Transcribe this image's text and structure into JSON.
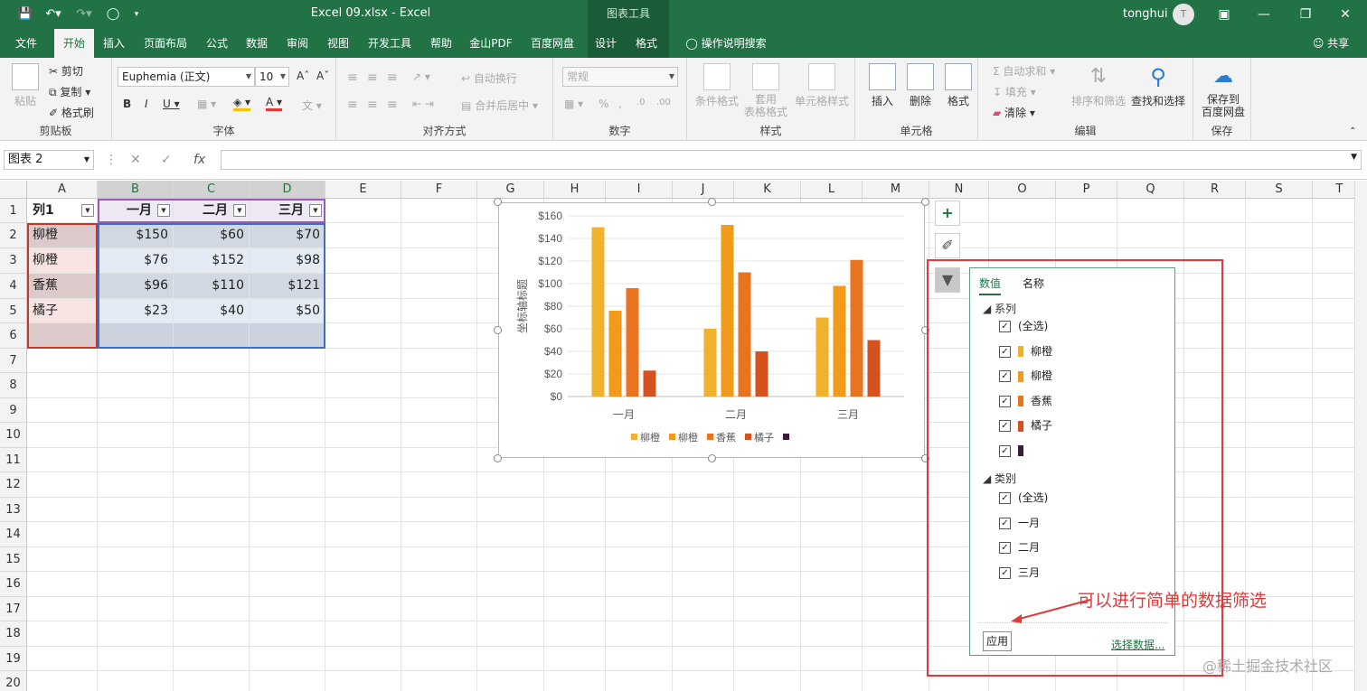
{
  "titlebar": {
    "document_title": "Excel 09.xlsx  -  Excel",
    "context_tools": "图表工具",
    "user": "tonghui",
    "avatar_letter": "T"
  },
  "menu": {
    "tabs": [
      "文件",
      "开始",
      "插入",
      "页面布局",
      "公式",
      "数据",
      "审阅",
      "视图",
      "开发工具",
      "帮助",
      "金山PDF",
      "百度网盘",
      "设计",
      "格式"
    ],
    "search_hint": "操作说明搜索",
    "share": "共享"
  },
  "ribbon": {
    "clipboard": {
      "label": "剪贴板",
      "paste": "粘贴",
      "cut": "剪切",
      "copy": "复制",
      "format_painter": "格式刷"
    },
    "font": {
      "label": "字体",
      "font_name": "Euphemia (正文)",
      "font_size": "10"
    },
    "alignment": {
      "label": "对齐方式",
      "wrap": "自动换行",
      "merge": "合并后居中"
    },
    "number": {
      "label": "数字",
      "format": "常规"
    },
    "styles": {
      "label": "样式",
      "conditional": "条件格式",
      "table_format_1": "套用",
      "table_format_2": "表格格式",
      "cell_styles": "单元格样式"
    },
    "cells": {
      "label": "单元格",
      "insert": "插入",
      "delete": "删除",
      "format": "格式"
    },
    "editing": {
      "label": "编辑",
      "autosum": "自动求和",
      "fill": "填充",
      "clear": "清除",
      "sort_filter": "排序和筛选",
      "find_select": "查找和选择"
    },
    "save": {
      "label": "保存",
      "save_to": "保存到",
      "baidu": "百度网盘"
    }
  },
  "formula_bar": {
    "name_box": "图表 2",
    "fx": "fx",
    "formula": ""
  },
  "sheet": {
    "columns": [
      "A",
      "B",
      "C",
      "D",
      "E",
      "F",
      "G",
      "H",
      "I",
      "J",
      "K",
      "L",
      "M",
      "N",
      "O",
      "P",
      "Q",
      "R",
      "S",
      "T"
    ],
    "rows": [
      "1",
      "2",
      "3",
      "4",
      "5",
      "6",
      "7",
      "8",
      "9",
      "10",
      "11",
      "12",
      "13",
      "14",
      "15",
      "16",
      "17",
      "18",
      "19",
      "20"
    ],
    "headers": [
      "列1",
      "一月",
      "二月",
      "三月"
    ],
    "data": [
      [
        "柳橙",
        "$150",
        "$60",
        "$70"
      ],
      [
        "柳橙",
        "$76",
        "$152",
        "$98"
      ],
      [
        "香蕉",
        "$96",
        "$110",
        "$121"
      ],
      [
        "橘子",
        "$23",
        "$40",
        "$50"
      ]
    ]
  },
  "chart_data": {
    "type": "bar",
    "categories": [
      "一月",
      "二月",
      "三月"
    ],
    "series": [
      {
        "name": "柳橙",
        "values": [
          150,
          60,
          70
        ],
        "color": "#f0b12c"
      },
      {
        "name": "柳橙",
        "values": [
          76,
          152,
          98
        ],
        "color": "#f19a1c"
      },
      {
        "name": "香蕉",
        "values": [
          96,
          110,
          121
        ],
        "color": "#e8741e"
      },
      {
        "name": "橘子",
        "values": [
          23,
          40,
          50
        ],
        "color": "#d5521e"
      },
      {
        "name": "",
        "values": [
          0,
          0,
          0
        ],
        "color": "#3b1a3a"
      }
    ],
    "title": "",
    "xlabel": "",
    "ylabel": "坐标轴标题",
    "ylim": [
      0,
      160
    ],
    "yticks": [
      "$0",
      "$20",
      "$40",
      "$60",
      "$80",
      "$100",
      "$120",
      "$140",
      "$160"
    ],
    "legend_position": "bottom",
    "grid": true
  },
  "filter_panel": {
    "tab_values": "数值",
    "tab_names": "名称",
    "series_section": "系列",
    "series_items": [
      "(全选)",
      "柳橙",
      "柳橙",
      "香蕉",
      "橘子",
      ""
    ],
    "category_section": "类别",
    "category_items": [
      "(全选)",
      "一月",
      "二月",
      "三月"
    ],
    "apply": "应用",
    "select_data": "选择数据..."
  },
  "annotation": "可以进行简单的数据筛选",
  "watermark": "@稀土掘金技术社区"
}
